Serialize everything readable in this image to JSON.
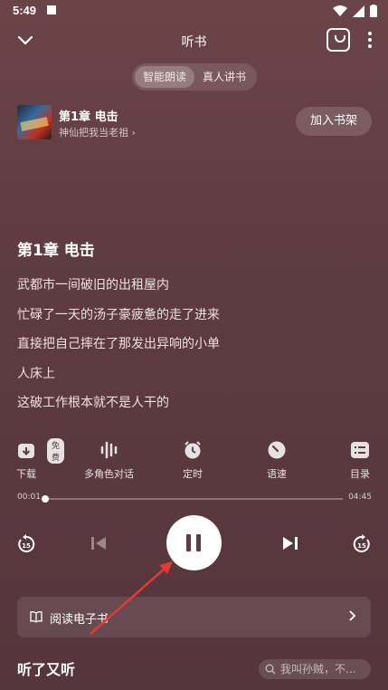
{
  "status": {
    "time": "5:49"
  },
  "header": {
    "title": "听书"
  },
  "modes": [
    {
      "label": "智能朗读",
      "active": true
    },
    {
      "label": "真人讲书",
      "active": false
    }
  ],
  "book": {
    "chapter": "第1章 电击",
    "author": "神仙把我当老祖",
    "author_chevron": "›",
    "shelf_label": "加入书架"
  },
  "reading": {
    "title": "第1章 电击",
    "lines": [
      "武都市一间破旧的出租屋内",
      "忙碌了一天的汤子豪疲惫的走了进来",
      "直接把自己摔在了那发出异响的小单",
      "人床上",
      "这破工作根本就不是人干的"
    ]
  },
  "tools": [
    {
      "icon": "download-icon",
      "label": "下载",
      "badge": "免费"
    },
    {
      "icon": "multi-voice-icon",
      "label": "多角色对话"
    },
    {
      "icon": "alarm-clock-icon",
      "label": "定时"
    },
    {
      "icon": "speed-icon",
      "label": "语速"
    },
    {
      "icon": "toc-icon",
      "label": "目录"
    }
  ],
  "progress": {
    "current": "00:01",
    "total": "04:45",
    "fraction": 0.004
  },
  "controls": {
    "rewind": "15",
    "forward": "15",
    "state": "playing"
  },
  "ebook": {
    "label": "阅读电子书"
  },
  "recommend": {
    "title": "听了又听",
    "search_placeholder": "我叫孙贼，不..."
  },
  "colors": {
    "background": "#5e3b40",
    "annotation_arrow": "#e53935"
  }
}
